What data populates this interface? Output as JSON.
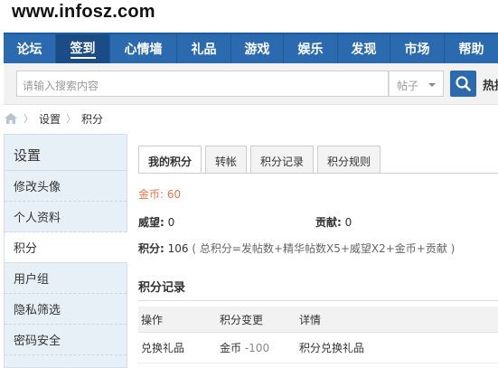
{
  "site": {
    "watermark": "www.infosz.com"
  },
  "nav": {
    "items": [
      {
        "label": "论坛"
      },
      {
        "label": "签到"
      },
      {
        "label": "心情墙"
      },
      {
        "label": "礼品"
      },
      {
        "label": "游戏"
      },
      {
        "label": "娱乐"
      },
      {
        "label": "发现"
      },
      {
        "label": "市场"
      },
      {
        "label": "帮助"
      }
    ]
  },
  "search": {
    "placeholder": "请输入搜索内容",
    "scope": "帖子",
    "hot_label": "热搜"
  },
  "breadcrumb": {
    "items": [
      "设置",
      "积分"
    ]
  },
  "sidebar": {
    "title": "设置",
    "items": [
      {
        "label": "修改头像"
      },
      {
        "label": "个人资料"
      },
      {
        "label": "积分"
      },
      {
        "label": "用户组"
      },
      {
        "label": "隐私筛选"
      },
      {
        "label": "密码安全"
      }
    ]
  },
  "tabs": [
    {
      "label": "我的积分"
    },
    {
      "label": "转帐"
    },
    {
      "label": "积分记录"
    },
    {
      "label": "积分规则"
    }
  ],
  "credits": {
    "gold_label": "金币:",
    "gold_value": "60",
    "prestige_label": "威望:",
    "prestige_value": "0",
    "contribution_label": "贡献:",
    "contribution_value": "0",
    "total_label": "积分:",
    "total_value": "106",
    "formula": "( 总积分=发帖数+精华帖数X5+威望X2+金币+贡献 )"
  },
  "records": {
    "title": "积分记录",
    "headers": [
      "操作",
      "积分变更",
      "详情"
    ],
    "rows": [
      {
        "action": "兑换礼品",
        "currency": "金币",
        "change": "-100",
        "detail": "积分兑换礼品"
      }
    ]
  },
  "colors": {
    "nav_bg": "#2b6aae",
    "gold_text": "#e6764a",
    "sidebar_bg": "#e8f0f7"
  }
}
